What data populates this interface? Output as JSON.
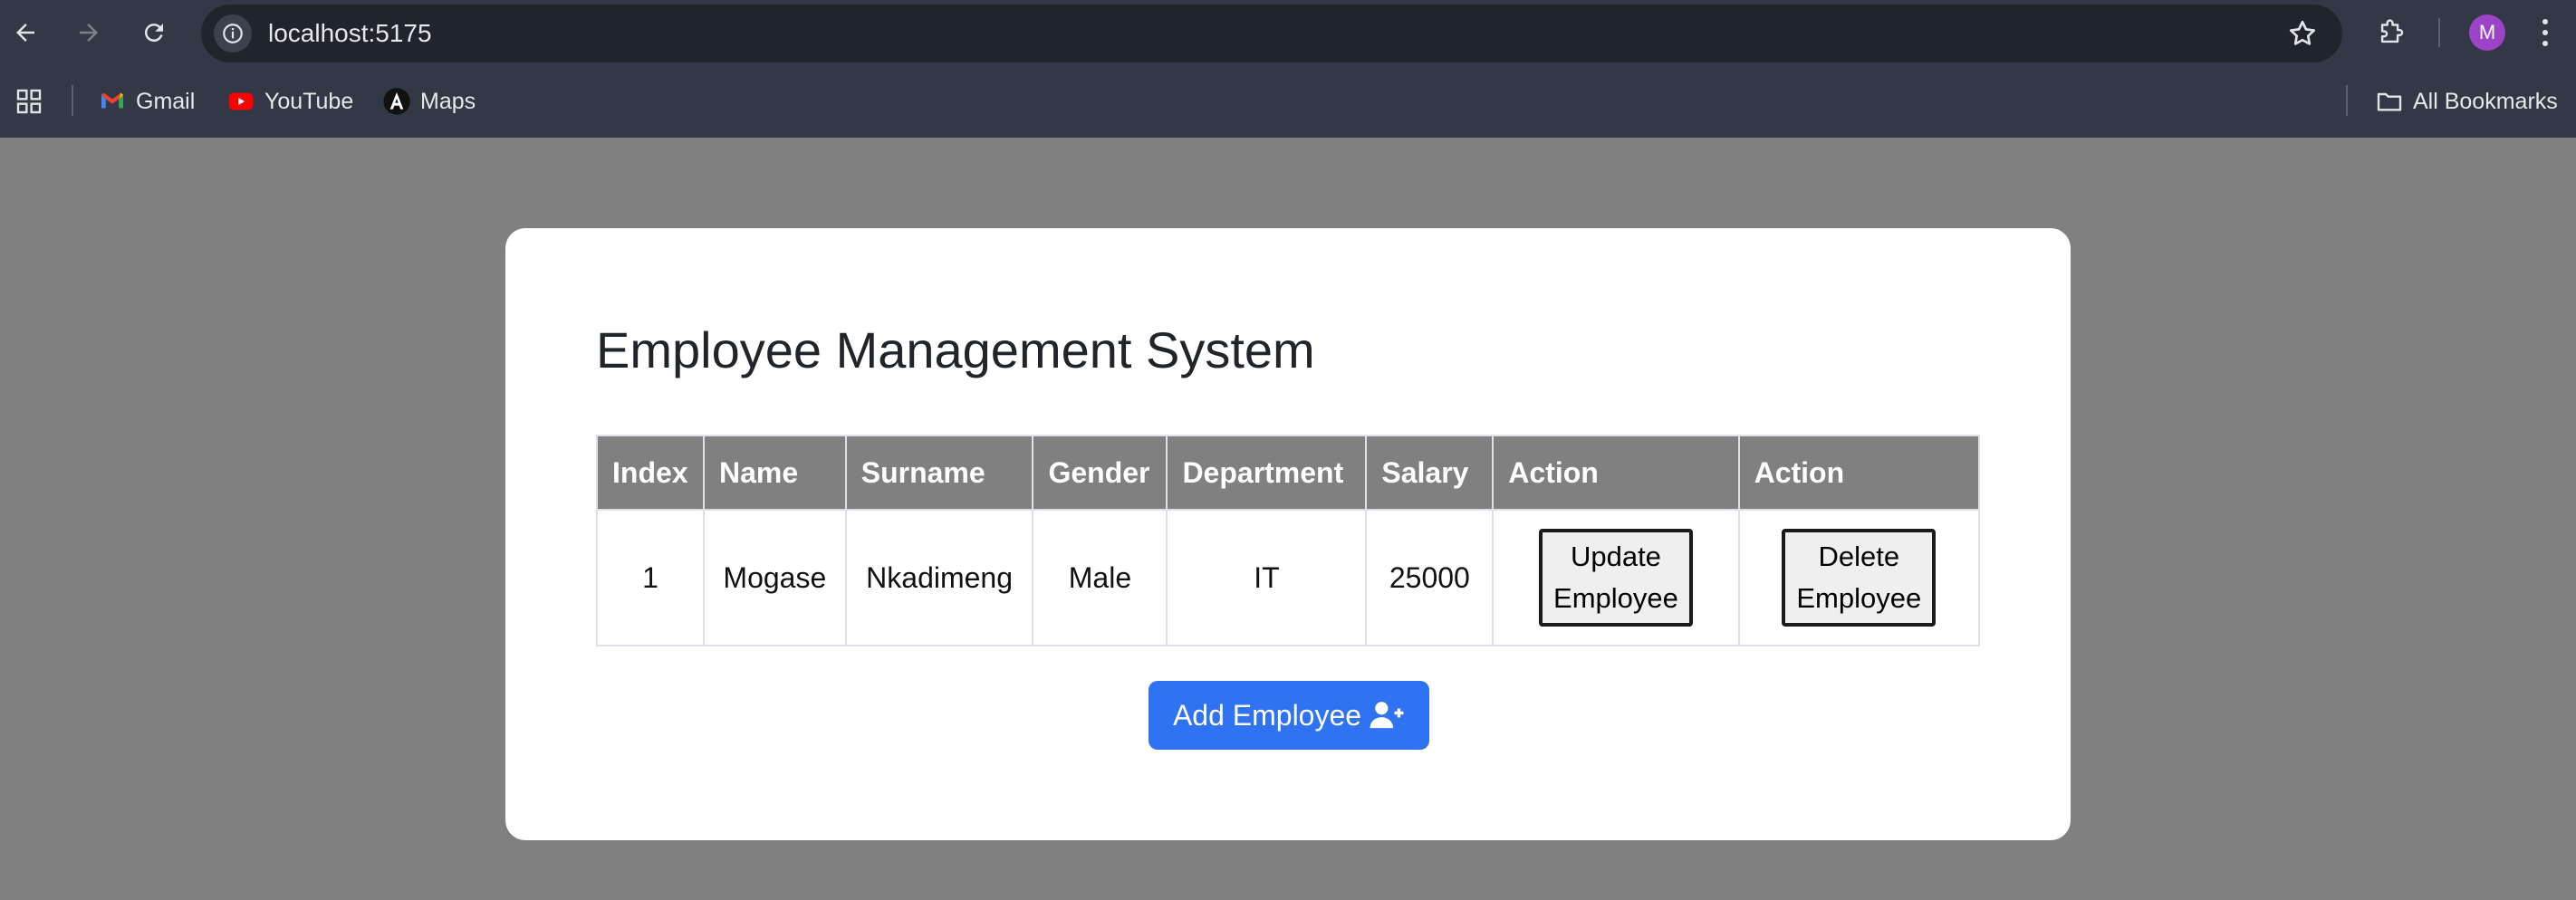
{
  "browser": {
    "url": "localhost:5175",
    "profile_initial": "M",
    "bookmarks": [
      {
        "label": "Gmail",
        "icon": "gmail-icon"
      },
      {
        "label": "YouTube",
        "icon": "youtube-icon"
      },
      {
        "label": "Maps",
        "icon": "angular-icon"
      }
    ],
    "all_bookmarks_label": "All Bookmarks"
  },
  "page": {
    "title": "Employee Management System",
    "table": {
      "headers": [
        "Index",
        "Name",
        "Surname",
        "Gender",
        "Department",
        "Salary",
        "Action",
        "Action"
      ],
      "rows": [
        {
          "index": "1",
          "name": "Mogase",
          "surname": "Nkadimeng",
          "gender": "Male",
          "department": "IT",
          "salary": "25000",
          "update_label_line1": "Update",
          "update_label_line2": "Employee",
          "delete_label_line1": "Delete",
          "delete_label_line2": "Employee"
        }
      ]
    },
    "add_button_label": "Add Employee",
    "add_button_icon": "user-plus-icon"
  },
  "colors": {
    "backdrop": "#808080",
    "header_bg": "#808080",
    "primary": "#2f73f3",
    "chrome": "#323845"
  }
}
